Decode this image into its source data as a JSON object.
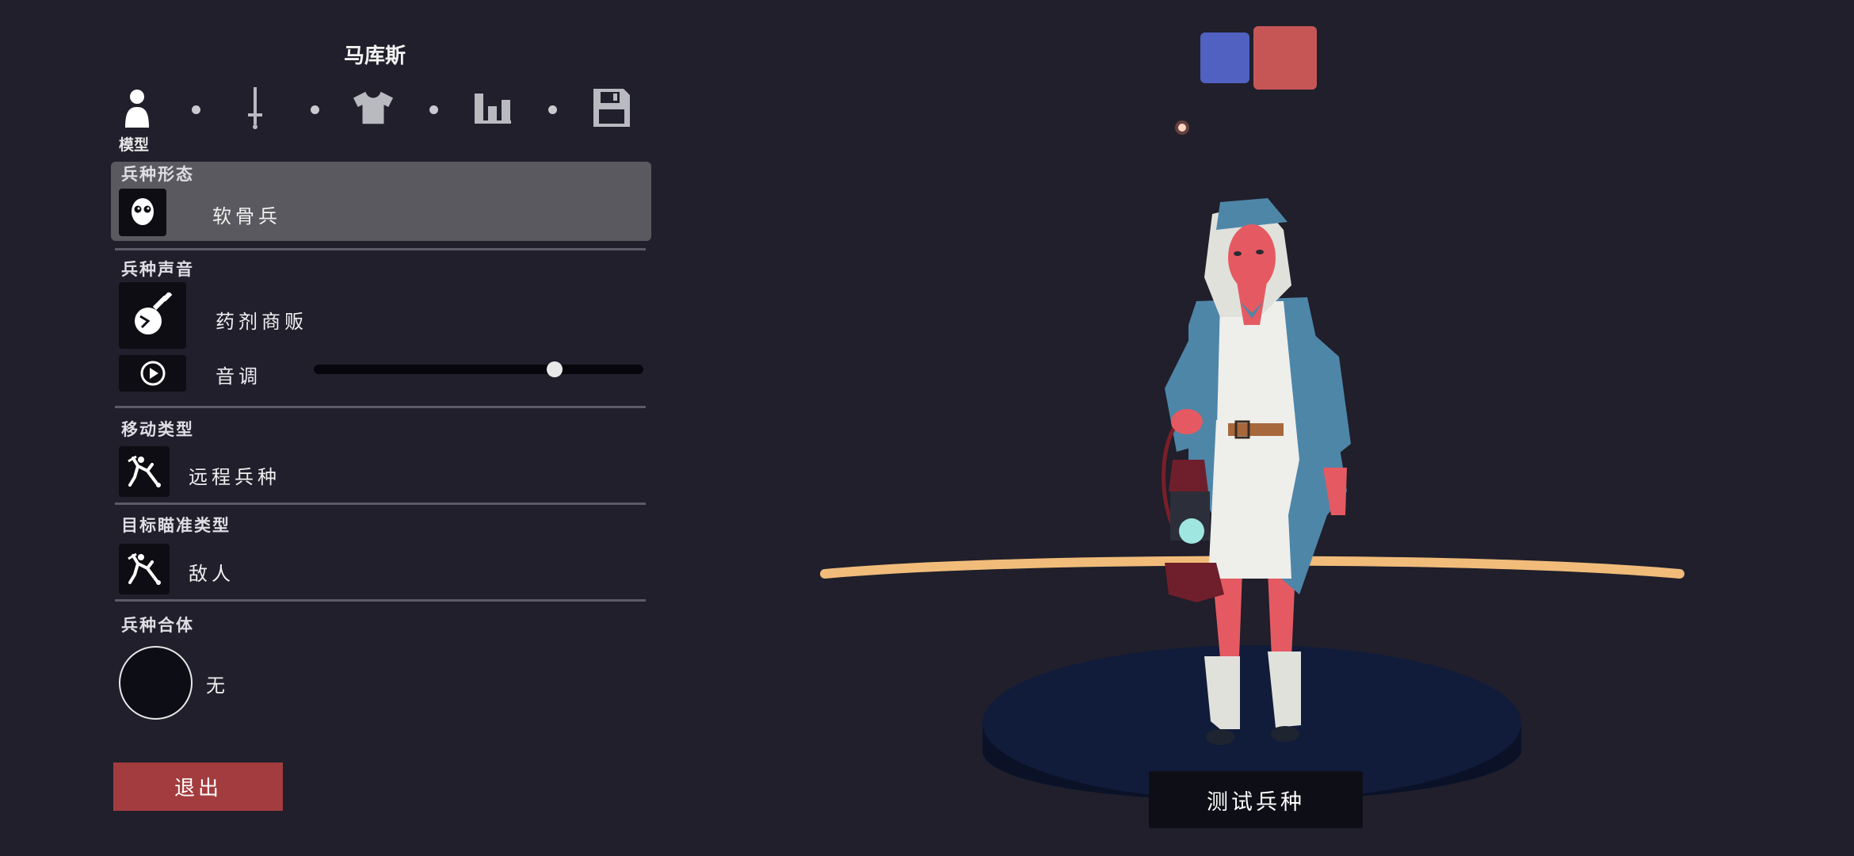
{
  "unit_name": "马库斯",
  "steps": [
    {
      "id": "model",
      "icon": "person-icon",
      "label": "模型",
      "active": true
    },
    {
      "id": "weapon",
      "icon": "sword-icon",
      "active": false
    },
    {
      "id": "clothing",
      "icon": "shirt-icon",
      "active": false
    },
    {
      "id": "stats",
      "icon": "bar-chart-icon",
      "active": false
    },
    {
      "id": "save",
      "icon": "save-icon",
      "active": false
    }
  ],
  "sections": {
    "form": {
      "label": "兵种形态",
      "value": "软骨兵",
      "icon": "skull-face-icon"
    },
    "voice": {
      "label": "兵种声音",
      "value": "药剂商贩",
      "icon": "potion-flask-icon",
      "pitch_label": "音调",
      "pitch_value": 0.73,
      "play_icon": "play-icon"
    },
    "movement": {
      "label": "移动类型",
      "value": "远程兵种",
      "icon": "ranged-unit-icon"
    },
    "targeting": {
      "label": "目标瞄准类型",
      "value": "敌人",
      "icon": "target-enemy-icon"
    },
    "combo": {
      "label": "兵种合体",
      "value": "无"
    }
  },
  "exit_label": "退出",
  "test_label": "测试兵种",
  "team_colors": {
    "blue": "#5061c2",
    "red": "#c65656"
  },
  "colors": {
    "background": "#201f2b",
    "accent_red": "#a33c3e",
    "highlight": "#5a595f",
    "ring": "#f1bc7a",
    "platform": "#0f1a35"
  }
}
